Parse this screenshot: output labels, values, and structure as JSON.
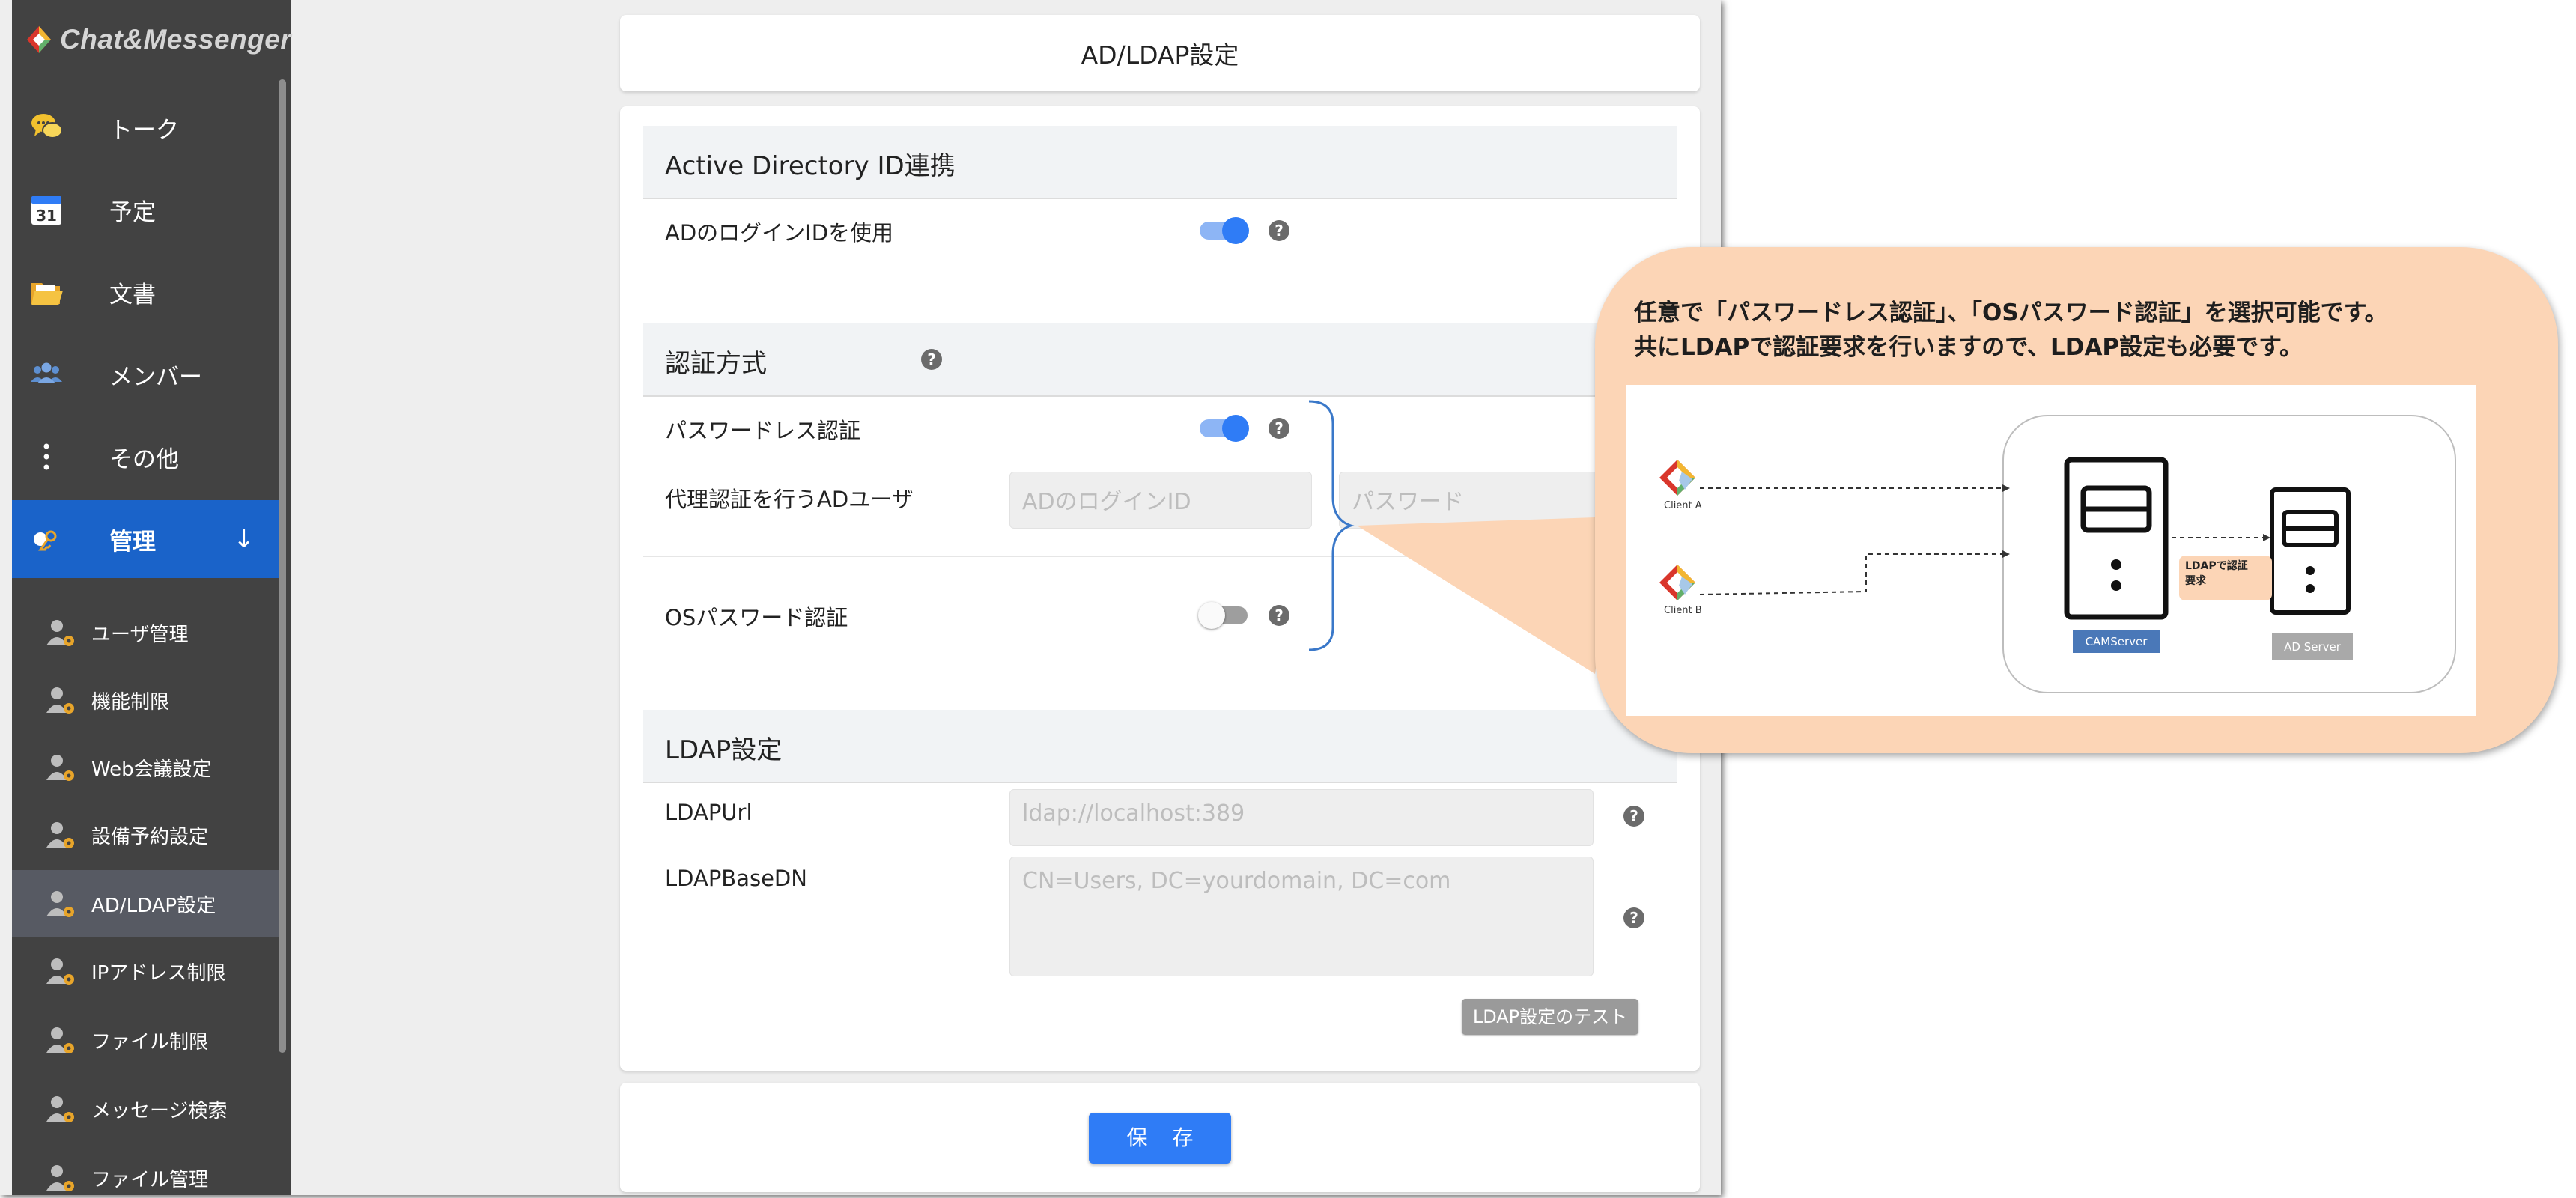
{
  "app": {
    "logo_text": "Chat&Messenger",
    "nav": [
      {
        "label": "トーク",
        "icon": "chat-bubbles-icon"
      },
      {
        "label": "予定",
        "icon": "calendar-icon"
      },
      {
        "label": "文書",
        "icon": "folder-icon"
      },
      {
        "label": "メンバー",
        "icon": "members-icon"
      },
      {
        "label": "その他",
        "icon": "more-vertical-icon"
      },
      {
        "label": "管理",
        "icon": "admin-key-icon",
        "active": true,
        "arrow": "↓"
      }
    ],
    "admin_menu": [
      {
        "label": "ユーザ管理"
      },
      {
        "label": "機能制限"
      },
      {
        "label": "Web会議設定"
      },
      {
        "label": "設備予約設定"
      },
      {
        "label": "AD/LDAP設定",
        "active": true
      },
      {
        "label": "IPアドレス制限"
      },
      {
        "label": "ファイル制限"
      },
      {
        "label": "メッセージ検索"
      },
      {
        "label": "ファイル管理"
      }
    ]
  },
  "page": {
    "title": "AD/LDAP設定",
    "ad_section": {
      "heading": "Active Directory ID連携",
      "use_ad_login_label": "ADのログインIDを使用",
      "use_ad_login_on": true
    },
    "auth_section": {
      "heading": "認証方式",
      "passwordless_label": "パスワードレス認証",
      "passwordless_on": true,
      "proxy_user_label": "代理認証を行うADユーザ",
      "proxy_login_placeholder": "ADのログインID",
      "proxy_password_placeholder": "パスワード",
      "os_password_label": "OSパスワード認証",
      "os_password_on": false
    },
    "ldap_section": {
      "heading": "LDAP設定",
      "url_label": "LDAPUrl",
      "url_placeholder": "ldap://localhost:389",
      "basedn_label": "LDAPBaseDN",
      "basedn_placeholder": "CN=Users, DC=yourdomain, DC=com",
      "test_button": "LDAP設定のテスト"
    },
    "save_button": "保 存"
  },
  "callout": {
    "line1": "任意で「パスワードレス認証」、「OSパスワード認証」を選択可能です。",
    "line2": "共にLDAPで認証要求を行いますので、LDAP設定も必要です。",
    "diagram": {
      "client_a": "Client A",
      "client_b": "Client B",
      "cam_server": "CAMServer",
      "ad_server": "AD Server",
      "request_label_1": "LDAPで認証",
      "request_label_2": "要求"
    }
  },
  "colors": {
    "sidebar_bg": "#424242",
    "active_nav": "#1a63c9",
    "toggle_on": "#2f7cf6",
    "save_button": "#2f7cf6",
    "callout_bg": "#fcd5b6",
    "brace": "#3a78c9"
  }
}
